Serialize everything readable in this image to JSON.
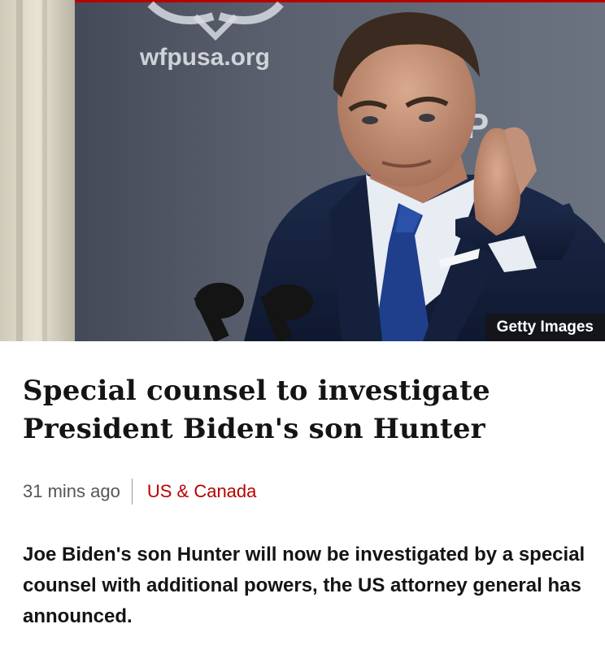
{
  "image": {
    "watermark_text": "wfpusa.org",
    "backdrop_text": "FP",
    "credit": "Getty Images"
  },
  "article": {
    "headline": "Special counsel to investigate President Biden's son Hunter",
    "timestamp": "31 mins ago",
    "section": "US & Canada",
    "summary": "Joe Biden's son Hunter will now be investigated by a special counsel with additional powers, the US attorney general has announced."
  },
  "colors": {
    "section_link": "#b80000",
    "headline": "#141414",
    "timestamp": "#545658",
    "top_accent": "#b80000"
  }
}
